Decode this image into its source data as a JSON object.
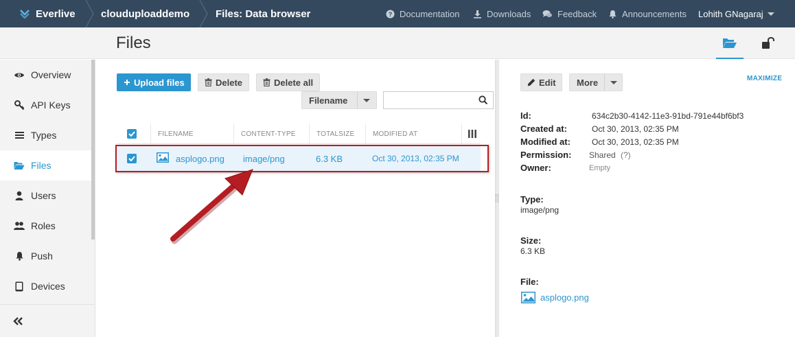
{
  "topbar": {
    "brand": "Everlive",
    "project": "clouduploaddemo",
    "page": "Files: Data browser",
    "links": [
      "Documentation",
      "Downloads",
      "Feedback",
      "Announcements"
    ],
    "user": "Lohith GNagaraj"
  },
  "header": {
    "title": "Files"
  },
  "sidebar": {
    "items": [
      {
        "label": "Overview",
        "icon": "eye-icon"
      },
      {
        "label": "API Keys",
        "icon": "key-icon"
      },
      {
        "label": "Types",
        "icon": "list-icon"
      },
      {
        "label": "Files",
        "icon": "folder-open-icon"
      },
      {
        "label": "Users",
        "icon": "user-icon"
      },
      {
        "label": "Roles",
        "icon": "users-icon"
      },
      {
        "label": "Push",
        "icon": "bell-icon"
      },
      {
        "label": "Devices",
        "icon": "tablet-icon"
      }
    ],
    "active": "Files"
  },
  "toolbar": {
    "upload": "Upload files",
    "delete": "Delete",
    "delete_all": "Delete all",
    "filter_field": "Filename",
    "search_placeholder": ""
  },
  "grid": {
    "columns": [
      "FILENAME",
      "CONTENT-TYPE",
      "TOTALSIZE",
      "MODIFIED AT"
    ],
    "rows": [
      {
        "filename": "asplogo.png",
        "content_type": "image/png",
        "totalsize": "6.3 KB",
        "modified_at": "Oct 30, 2013, 02:35 PM",
        "selected": true
      }
    ]
  },
  "details": {
    "edit": "Edit",
    "more": "More",
    "maximize": "MAXIMIZE",
    "id_label": "Id:",
    "id": "634c2b30-4142-11e3-91bd-791e44bf6bf3",
    "created_label": "Created at:",
    "created": "Oct 30, 2013, 02:35 PM",
    "modified_label": "Modified at:",
    "modified": "Oct 30, 2013, 02:35 PM",
    "permission_label": "Permission:",
    "permission": "Shared",
    "permission_help": "(?)",
    "owner_label": "Owner:",
    "owner": "Empty",
    "type_label": "Type:",
    "type": "image/png",
    "size_label": "Size:",
    "size": "6.3 KB",
    "file_label": "File:",
    "file": "asplogo.png"
  },
  "colors": {
    "topbar": "#34495e",
    "accent": "#2b96cf",
    "highlight_outline": "#b51d22",
    "annotation_arrow": "#b51d22"
  }
}
